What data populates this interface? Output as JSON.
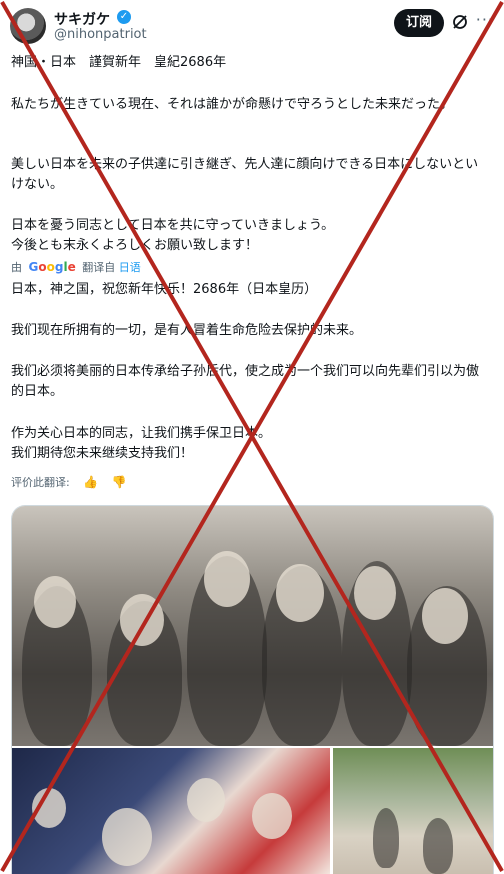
{
  "user": {
    "name": "サキガケ",
    "handle": "@nihonpatriot",
    "verified_mark": "✓"
  },
  "actions": {
    "subscribe_label": "订阅",
    "more_label": "···"
  },
  "post": {
    "jp_lines": [
      "神国・日本　謹賀新年　皇紀2686年",
      "私たちが生きている現在、それは誰かが命懸けで守ろうとした未来だった。",
      "美しい日本を未来の子供達に引き継ぎ、先人達に顔向けできる日本にしないといけない。",
      "日本を憂う同志として日本を共に守っていきましょう。",
      "今後とも末永くよろしくお願い致します！"
    ],
    "translated_by": {
      "prefix": "由",
      "google_letters": [
        "G",
        "o",
        "o",
        "g",
        "l",
        "e"
      ],
      "suffix": "翻译自",
      "language": "日语"
    },
    "zh_lines": [
      "日本，神之国，祝您新年快乐！2686年（日本皇历）",
      "我们现在所拥有的一切，是有人冒着生命危险去保护的未来。",
      "我们必须将美丽的日本传承给子孙后代，使之成为一个我们可以向先辈们引以为傲的日本。",
      "作为关心日本的同志，让我们携手保卫日本。",
      "我们期待您未来继续支持我们！"
    ],
    "rate_label": "评价此翻译:",
    "rate_icons": [
      "thumbs-up-icon",
      "thumbs-down-icon"
    ]
  },
  "colors": {
    "accent": "#1d9bf0",
    "cross": "#b3261e"
  }
}
